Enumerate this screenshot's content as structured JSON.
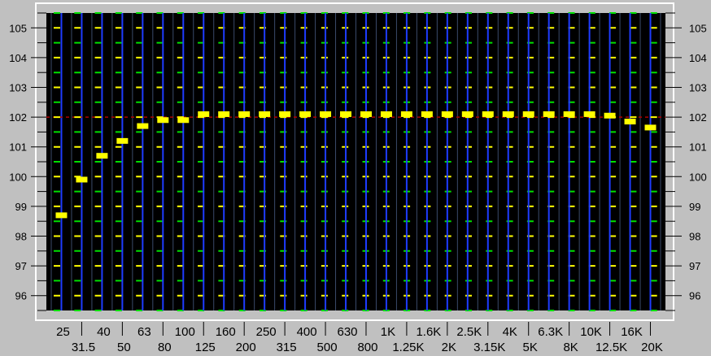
{
  "chart_data": {
    "type": "bar",
    "title": "",
    "xlabel": "",
    "ylabel": "",
    "ylim": [
      95.5,
      105.5
    ],
    "yticks": [
      96,
      97,
      98,
      99,
      100,
      101,
      102,
      103,
      104,
      105
    ],
    "ytick_labels": [
      "96",
      "97",
      "98",
      "99",
      "100",
      "101",
      "102",
      "103",
      "104",
      "105"
    ],
    "categories": [
      "25",
      "31.5",
      "40",
      "50",
      "63",
      "80",
      "100",
      "125",
      "160",
      "200",
      "250",
      "315",
      "400",
      "500",
      "630",
      "800",
      "1K",
      "1.25K",
      "1.6K",
      "2K",
      "2.5K",
      "3.15K",
      "4K",
      "5K",
      "6.3K",
      "8K",
      "10K",
      "12.5K",
      "16K",
      "20K"
    ],
    "values": [
      98.7,
      99.9,
      100.7,
      101.2,
      101.7,
      101.9,
      101.9,
      102.1,
      102.1,
      102.1,
      102.1,
      102.1,
      102.1,
      102.1,
      102.1,
      102.1,
      102.1,
      102.1,
      102.1,
      102.1,
      102.1,
      102.1,
      102.1,
      102.1,
      102.1,
      102.1,
      102.1,
      102.05,
      101.85,
      101.65
    ],
    "reference_level": 102,
    "grid": true,
    "colors": {
      "plot_bg": "#000000",
      "frame": "#c0c0c0",
      "marker": "#ffff00",
      "band_line": "#1e3cff",
      "grid_green": "#00e000",
      "grid_yellow": "#ffff00",
      "reference_line": "#b00000"
    }
  }
}
